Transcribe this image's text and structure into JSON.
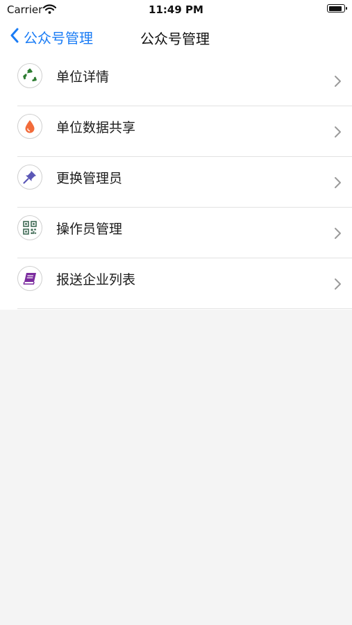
{
  "status_bar": {
    "carrier": "Carrier",
    "time": "11:49 PM",
    "battery_level": 0.9
  },
  "nav": {
    "back_label": "公众号管理",
    "title": "公众号管理",
    "accent_color": "#1a7cf5"
  },
  "menu": {
    "items": [
      {
        "label": "单位详情",
        "icon": "recycle-icon",
        "icon_color": "#2e7d32"
      },
      {
        "label": "单位数据共享",
        "icon": "droplet-icon",
        "icon_color": "#f26b3a"
      },
      {
        "label": "更换管理员",
        "icon": "pushpin-icon",
        "icon_color": "#5b57b6"
      },
      {
        "label": "操作员管理",
        "icon": "qr-code-icon",
        "icon_color": "#3f6b55"
      },
      {
        "label": "报送企业列表",
        "icon": "book-icon",
        "icon_color": "#7b2b9e"
      }
    ]
  }
}
